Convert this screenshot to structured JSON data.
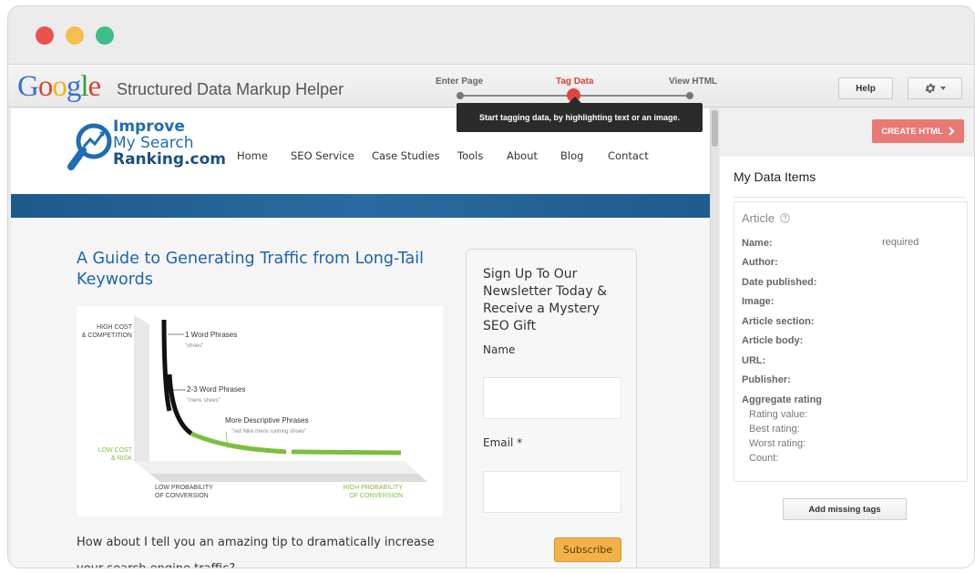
{
  "window": {
    "controls": [
      {
        "name": "close",
        "color": "#e9534f"
      },
      {
        "name": "minimize",
        "color": "#f6be4f"
      },
      {
        "name": "zoom",
        "color": "#3dbd89"
      }
    ]
  },
  "toolbar": {
    "logo_text": "Google",
    "app_name": "Structured Data Markup Helper",
    "steps": [
      {
        "label": "Enter Page",
        "state": "done"
      },
      {
        "label": "Tag Data",
        "state": "current"
      },
      {
        "label": "View HTML",
        "state": "pending"
      }
    ],
    "help_label": "Help",
    "settings_icon": "gear-icon",
    "tooltip": "Start tagging data, by highlighting text or an image."
  },
  "site": {
    "brand": {
      "line1": "Improve",
      "line2": "My Search",
      "line3": "Ranking.com"
    },
    "nav": [
      "Home",
      "SEO Service",
      "Case Studies",
      "Tools",
      "About",
      "Blog",
      "Contact"
    ],
    "article": {
      "title": "A Guide to Generating Traffic from Long-Tail Keywords",
      "body": "How about I tell you an amazing tip to dramatically increase your search engine traffic?"
    },
    "infographic": {
      "y_high": [
        "HIGH COST",
        "& COMPETITION"
      ],
      "y_low": [
        "LOW COST",
        "& RISK"
      ],
      "x_low": [
        "LOW PROBABILITY",
        "OF CONVERSION"
      ],
      "x_high": [
        "HIGH PROBABILITY",
        "OF CONVERSION"
      ],
      "labels": [
        {
          "title": "1 Word Phrases",
          "example": "\"shoes\""
        },
        {
          "title": "2-3 Word Phrases",
          "example": "\"mens shoes\""
        },
        {
          "title": "More Descriptive Phrases",
          "example": "\"red Nike mens running shoes\""
        }
      ],
      "colors": {
        "head": "#111111",
        "tail": "#7cbf3e",
        "axis_green": "#7cbf3e"
      }
    },
    "newsletter": {
      "title": "Sign Up To Our Newsletter Today & Receive a Mystery SEO Gift",
      "name_label": "Name",
      "email_label": "Email *",
      "subscribe_label": "Subscribe"
    }
  },
  "panel": {
    "create_html_label": "CREATE HTML",
    "my_data_items_title": "My Data Items",
    "card_title": "Article",
    "help_icon": "question-circle-icon",
    "required_note": "required",
    "fields": [
      "Name:",
      "Author:",
      "Date published:",
      "Image:",
      "Article section:",
      "Article body:",
      "URL:",
      "Publisher:",
      "Aggregate rating"
    ],
    "subfields": [
      "Rating value:",
      "Best rating:",
      "Worst rating:",
      "Count:"
    ],
    "add_missing_label": "Add missing tags"
  }
}
